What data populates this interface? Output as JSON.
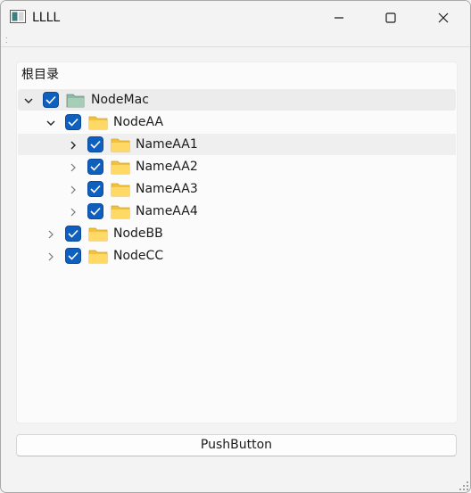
{
  "window": {
    "title": "LLLL"
  },
  "tree": {
    "header": "根目录",
    "nodes": [
      {
        "label": "NodeMac",
        "checked": true,
        "expanded": true,
        "icon": "folder-icon-open"
      },
      {
        "label": "NodeAA",
        "checked": true,
        "expanded": true,
        "icon": "folder-icon"
      },
      {
        "label": "NameAA1",
        "checked": true,
        "expanded": false,
        "icon": "folder-icon"
      },
      {
        "label": "NameAA2",
        "checked": true,
        "expanded": false,
        "icon": "folder-icon"
      },
      {
        "label": "NameAA3",
        "checked": true,
        "expanded": false,
        "icon": "folder-icon"
      },
      {
        "label": "NameAA4",
        "checked": true,
        "expanded": false,
        "icon": "folder-icon"
      },
      {
        "label": "NodeBB",
        "checked": true,
        "expanded": false,
        "icon": "folder-icon"
      },
      {
        "label": "NodeCC",
        "checked": true,
        "expanded": false,
        "icon": "folder-icon"
      }
    ]
  },
  "button": {
    "label": "PushButton"
  },
  "colors": {
    "accent": "#0f5fbf",
    "folder": "#f7c948"
  }
}
